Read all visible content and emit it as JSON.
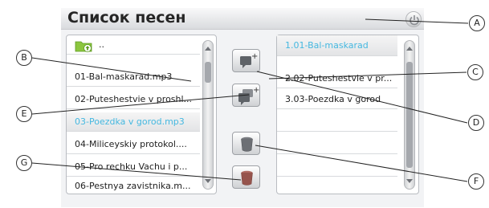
{
  "window": {
    "title": "Список песен"
  },
  "source_list": {
    "items": [
      {
        "label": "..",
        "icon": "folder-up-icon"
      },
      {
        "label": "01-Bal-maskarad.mp3"
      },
      {
        "label": "02-Puteshestvie v proshl..."
      },
      {
        "label": "03-Poezdka v gorod.mp3",
        "selected": true
      },
      {
        "label": "04-Miliceyskiy protokol...."
      },
      {
        "label": "05-Pro rechku Vachu i p..."
      },
      {
        "label": "06-Pestnya zavistnika.m..."
      }
    ]
  },
  "playlist": {
    "items": [
      {
        "label": "1.01-Bal-maskarad",
        "selected": true
      },
      {
        "label": "2.02-Puteshestvie v pr..."
      },
      {
        "label": "3.03-Poezdka v gorod"
      },
      {
        "label": ""
      },
      {
        "label": ""
      },
      {
        "label": ""
      },
      {
        "label": ""
      }
    ]
  },
  "callouts": {
    "a": "A",
    "b": "B",
    "c": "C",
    "d": "D",
    "e": "E",
    "f": "F",
    "g": "G"
  },
  "colors": {
    "selected_text": "#45b8e0",
    "panel_border": "#b9bcc1"
  }
}
